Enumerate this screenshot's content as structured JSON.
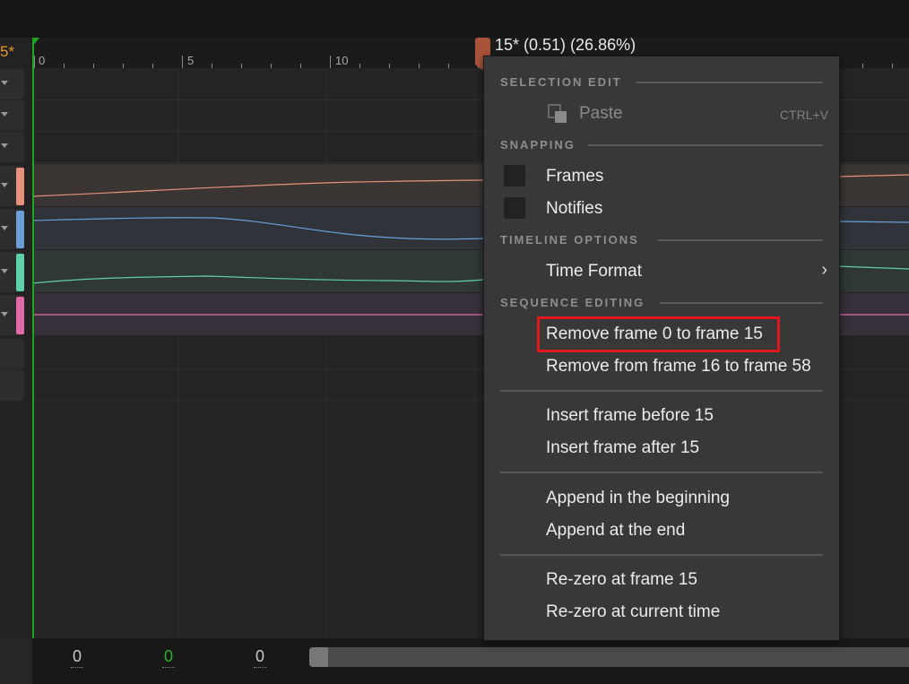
{
  "header": {
    "current_frame": "5*",
    "scrub_label": "15* (0.51) (26.86%)"
  },
  "ruler": {
    "labels": [
      "0",
      "5",
      "10"
    ]
  },
  "tracks": {
    "colors": [
      "#e8917a",
      "#6a9ed8",
      "#5fd1a8",
      "#e06aa8"
    ]
  },
  "footer": {
    "counters": [
      "0",
      "0",
      "0"
    ],
    "counter_colors": [
      "#c8c8c8",
      "#2fae2f",
      "#c8c8c8"
    ]
  },
  "menu": {
    "selection_edit_header": "SELECTION EDIT",
    "paste_label": "Paste",
    "paste_shortcut": "CTRL+V",
    "snapping_header": "SNAPPING",
    "snap_frames_label": "Frames",
    "snap_notifies_label": "Notifies",
    "timeline_options_header": "TIMELINE OPTIONS",
    "time_format_label": "Time Format",
    "sequence_editing_header": "SEQUENCE EDITING",
    "remove_before_label": "Remove frame 0 to frame 15",
    "remove_after_label": "Remove from frame 16 to frame 58",
    "insert_before_label": "Insert frame before 15",
    "insert_after_label": "Insert frame after 15",
    "append_beginning_label": "Append in the beginning",
    "append_end_label": "Append at the end",
    "rezero_frame_label": "Re-zero at frame 15",
    "rezero_current_label": "Re-zero at current time"
  },
  "icons": {
    "paste": "paste-icon",
    "submenu": "chevron-right-icon",
    "track_menu": "dropdown-arrow-icon"
  }
}
